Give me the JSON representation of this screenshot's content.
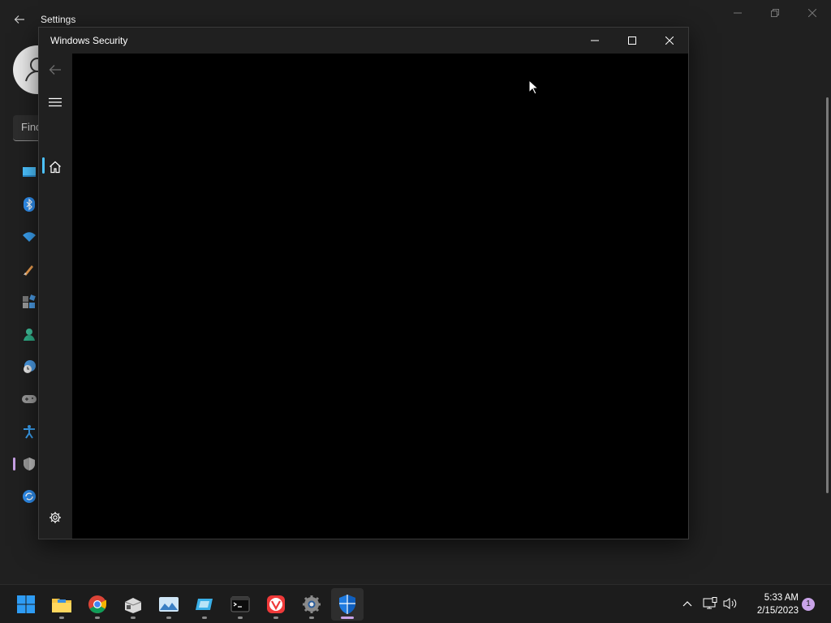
{
  "settings": {
    "title": "Settings",
    "search_placeholder": "Find",
    "nav_icons": [
      "system-icon",
      "bluetooth-icon",
      "network-icon",
      "personalization-icon",
      "apps-icon",
      "accounts-icon",
      "time-language-icon",
      "gaming-icon",
      "accessibility-icon",
      "privacy-security-icon",
      "windows-update-icon"
    ],
    "active_item": "privacy-security-icon"
  },
  "security_window": {
    "title": "Windows Security",
    "nav_icons": [
      "back-icon",
      "menu-icon",
      "home-icon",
      "settings-icon"
    ],
    "selected_nav": "home-icon"
  },
  "taskbar": {
    "apps": [
      "start-icon",
      "file-explorer-icon",
      "chrome-icon",
      "app-installer-icon",
      "photos-icon",
      "snipping-tool-icon",
      "terminal-icon",
      "vivaldi-icon",
      "settings-icon",
      "windows-security-icon"
    ],
    "active_app": "windows-security-icon",
    "time": "5:33 AM",
    "date": "2/15/2023",
    "notification_count": "1"
  },
  "colors": {
    "accent": "#4cc2ff",
    "taskbar_indicator": "#c9a3e8",
    "window_bg": "#202020",
    "content_bg": "#000000"
  }
}
